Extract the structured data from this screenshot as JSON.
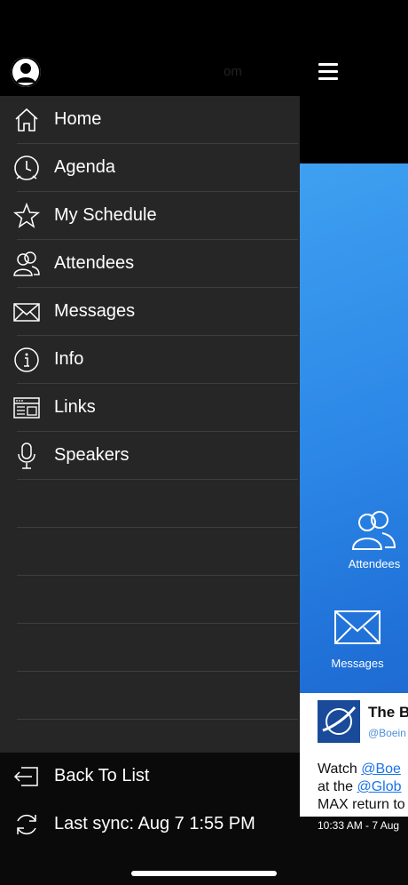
{
  "header": {
    "user_name": "",
    "user_email": "om"
  },
  "menu": {
    "items": [
      {
        "label": "Home",
        "icon": "home-icon"
      },
      {
        "label": "Agenda",
        "icon": "clock-icon"
      },
      {
        "label": "My Schedule",
        "icon": "star-icon"
      },
      {
        "label": "Attendees",
        "icon": "people-icon"
      },
      {
        "label": "Messages",
        "icon": "envelope-icon"
      },
      {
        "label": "Info",
        "icon": "info-icon"
      },
      {
        "label": "Links",
        "icon": "browser-icon"
      },
      {
        "label": "Speakers",
        "icon": "microphone-icon"
      }
    ]
  },
  "footer": {
    "back_label": "Back To List",
    "sync_label": "Last sync:  Aug 7 1:55 PM"
  },
  "background": {
    "attendees_label": "Attendees",
    "messages_label": "Messages",
    "tweet": {
      "name": "The B",
      "handle": "@Boein",
      "line1_prefix": "Watch ",
      "line1_link": "@Boe",
      "line2_prefix": "at the ",
      "line2_link": "@Glob",
      "line3": "MAX return to",
      "time": "10:33 AM - 7 Aug"
    }
  }
}
